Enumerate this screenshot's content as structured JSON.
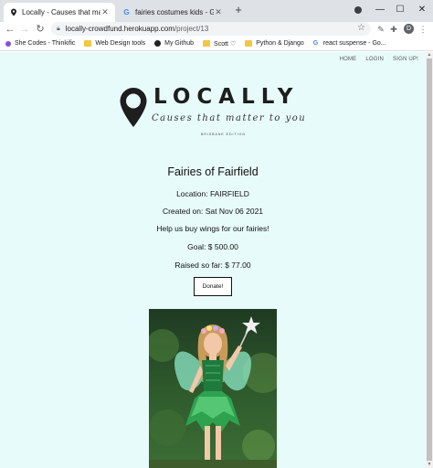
{
  "browser": {
    "tabs": [
      {
        "title": "Locally - Causes that matter to you",
        "favicon": "pin-icon",
        "active": true
      },
      {
        "title": "fairies costumes kids - Google Search",
        "favicon": "google-icon",
        "active": false
      }
    ],
    "new_tab": "+",
    "window_controls": {
      "minimize": "—",
      "maximize": "☐",
      "close": "✕"
    },
    "url": {
      "host": "locally-crowdfund.herokuapp.com",
      "path": "/project/13"
    },
    "profile_initial": "D",
    "bookmarks": [
      {
        "label": "She Codes - Thinkific",
        "icon": "thinkific-icon"
      },
      {
        "label": "Web Design tools",
        "icon": "folder-icon"
      },
      {
        "label": "My Github",
        "icon": "github-icon"
      },
      {
        "label": "Scott ♡",
        "icon": "folder-icon"
      },
      {
        "label": "Python & Django",
        "icon": "folder-icon"
      },
      {
        "label": "react suspense - Go...",
        "icon": "google-icon"
      }
    ]
  },
  "site": {
    "nav": {
      "home": "HOME",
      "login": "LOGIN",
      "signup": "SIGN UP!"
    },
    "logo": {
      "word": "LOCALLY",
      "tagline": "Causes that matter to you",
      "edition": "BRISBANE EDITION"
    }
  },
  "project": {
    "title": "Fairies of Fairfield",
    "location": "Location: FAIRFIELD",
    "created": "Created on: Sat Nov 06 2021",
    "description": "Help us buy wings for our fairies!",
    "goal": "Goal: $ 500.00",
    "raised": "Raised so far: $ 77.00",
    "donate_label": "Donate!"
  },
  "colors": {
    "page_bg": "#e8fbfb",
    "text": "#111111"
  }
}
